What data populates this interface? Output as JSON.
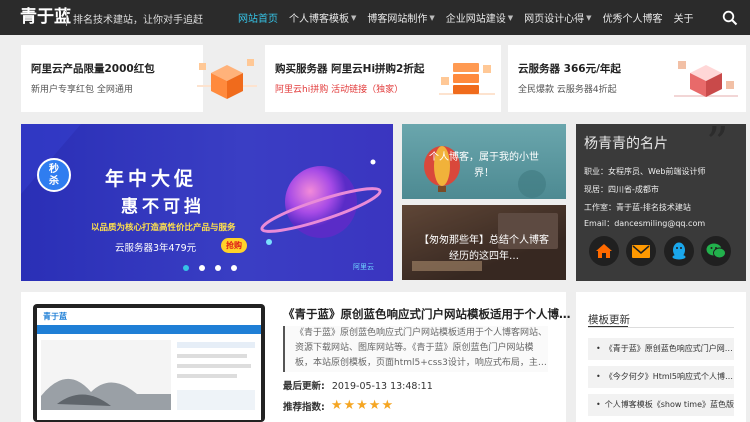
{
  "header": {
    "brand": "青于蓝",
    "tagline": "排名技术建站，让你对手追赶",
    "nav": [
      {
        "label": "网站首页",
        "active": true,
        "dropdown": false
      },
      {
        "label": "个人博客模板",
        "active": false,
        "dropdown": true
      },
      {
        "label": "博客网站制作",
        "active": false,
        "dropdown": true
      },
      {
        "label": "企业网站建设",
        "active": false,
        "dropdown": true
      },
      {
        "label": "网页设计心得",
        "active": false,
        "dropdown": true
      },
      {
        "label": "优秀个人博客",
        "active": false,
        "dropdown": false
      },
      {
        "label": "关于",
        "active": false,
        "dropdown": false
      }
    ],
    "search_icon": "search-icon",
    "accent_color": "#36c3e6"
  },
  "ads": [
    {
      "title": "阿里云产品限量2000红包",
      "subtitle": "新用户专享红包 全网通用",
      "subtitle_red": false
    },
    {
      "title": "购买服务器 阿里云Hi拼购2折起",
      "subtitle": "阿里云hi拼购 活动链接（独家）",
      "subtitle_red": true
    },
    {
      "title": "云服务器 366元/年起",
      "subtitle": "全民爆款 云服务器4折起",
      "subtitle_red": false
    }
  ],
  "banner": {
    "badge": "秒杀",
    "headline": "年中大促",
    "sub_headline": "惠不可挡",
    "tagline": "以品质为核心打造高性价比产品与服务",
    "price_text": "云服务器3年479元",
    "tag": "抢购",
    "logo_text": "阿里云",
    "dots": 4,
    "active_dot": 0
  },
  "thumbs": [
    {
      "text": "个人博客，属于我的小世界！"
    },
    {
      "text": "【匆匆那些年】总结个人博客经历的这四年…"
    }
  ],
  "profile": {
    "title": "杨青青的名片",
    "lines": [
      "职业：女程序员、Web前端设计师",
      "现居：四川省-成都市",
      "工作室：青于蓝-排名技术建站",
      "Email：dancesmiling@qq.com"
    ],
    "icons": [
      "home-icon",
      "mail-icon",
      "qq-icon",
      "wechat-icon"
    ]
  },
  "article": {
    "title": "《青于蓝》原创蓝色响应式门户网站模板适用于个人博…",
    "summary": "《青于蓝》原创蓝色响应式门户网站模板适用于个人博客网站、资源下载网站、图库网站等。《青于蓝》原创蓝色门户网站模板，本站原创模板，页面html5+css3设计，响应式布局，主…",
    "updated_label": "最后更新:",
    "updated_value": "2019-05-13 13:48:11",
    "rating_label": "推荐指数:",
    "rating": 5,
    "thumb_brand": "青于蓝"
  },
  "sidebar": {
    "heading": "模板更新",
    "items": [
      "《青于蓝》原创蓝色响应式门户网…",
      "《今夕何夕》Html5响应式个人博…",
      "个人博客模板《show time》蓝色版"
    ]
  }
}
